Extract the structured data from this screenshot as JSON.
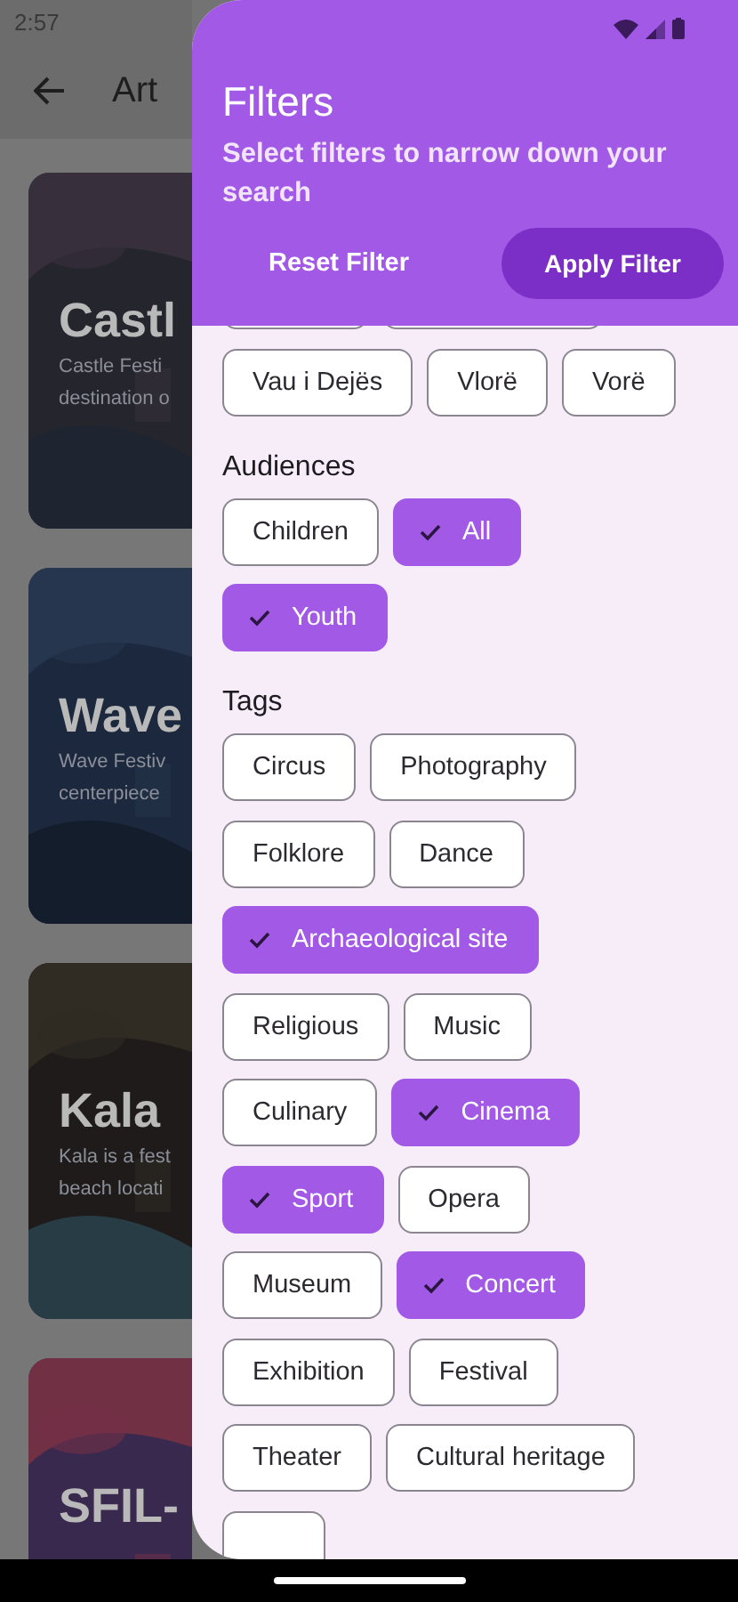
{
  "status_bar": {
    "time": "2:57"
  },
  "app_bar": {
    "title": "Art"
  },
  "events": [
    {
      "title": "Castl",
      "description": [
        "Castle Festi",
        "destination o"
      ]
    },
    {
      "title": "Wave",
      "description": [
        "Wave Festiv",
        "centerpiece"
      ]
    },
    {
      "title": "Kala",
      "description": [
        "Kala is a fest",
        "beach locati"
      ]
    },
    {
      "title": "SFIL-"
    }
  ],
  "filters": {
    "title": "Filters",
    "subtitle": "Select filters to narrow down your search",
    "reset_label": "Reset Filter",
    "apply_label": "Apply Filter",
    "groups": [
      {
        "options": [
          {
            "kind": "partial",
            "selected": false
          },
          {
            "kind": "partial",
            "selected": false
          },
          {
            "kind": "chip",
            "label": "Vau i Dejës",
            "selected": false
          },
          {
            "kind": "chip",
            "label": "Vlorë",
            "selected": false
          },
          {
            "kind": "chip",
            "label": "Vorë",
            "selected": false
          }
        ]
      },
      {
        "title": "Audiences",
        "options": [
          {
            "kind": "chip",
            "label": "Children",
            "selected": false
          },
          {
            "kind": "chip",
            "label": "All",
            "selected": true
          },
          {
            "kind": "chip",
            "label": "Youth",
            "selected": true
          }
        ]
      },
      {
        "title": "Tags",
        "options": [
          {
            "kind": "chip",
            "label": "Circus",
            "selected": false
          },
          {
            "kind": "chip",
            "label": "Photography",
            "selected": false
          },
          {
            "kind": "chip",
            "label": "Folklore",
            "selected": false
          },
          {
            "kind": "chip",
            "label": "Dance",
            "selected": false
          },
          {
            "kind": "chip",
            "label": "Archaeological site",
            "selected": true
          },
          {
            "kind": "chip",
            "label": "Religious",
            "selected": false
          },
          {
            "kind": "chip",
            "label": "Music",
            "selected": false
          },
          {
            "kind": "chip",
            "label": "Culinary",
            "selected": false
          },
          {
            "kind": "chip",
            "label": "Cinema",
            "selected": true
          },
          {
            "kind": "chip",
            "label": "Sport",
            "selected": true
          },
          {
            "kind": "chip",
            "label": "Opera",
            "selected": false
          },
          {
            "kind": "chip",
            "label": "Museum",
            "selected": false
          },
          {
            "kind": "chip",
            "label": "Concert",
            "selected": true
          },
          {
            "kind": "chip",
            "label": "Exhibition",
            "selected": false
          },
          {
            "kind": "chip",
            "label": "Festival",
            "selected": false
          },
          {
            "kind": "chip",
            "label": "Theater",
            "selected": false
          },
          {
            "kind": "chip",
            "label": "Cultural heritage",
            "selected": false
          },
          {
            "kind": "partial",
            "selected": false
          }
        ]
      }
    ]
  }
}
